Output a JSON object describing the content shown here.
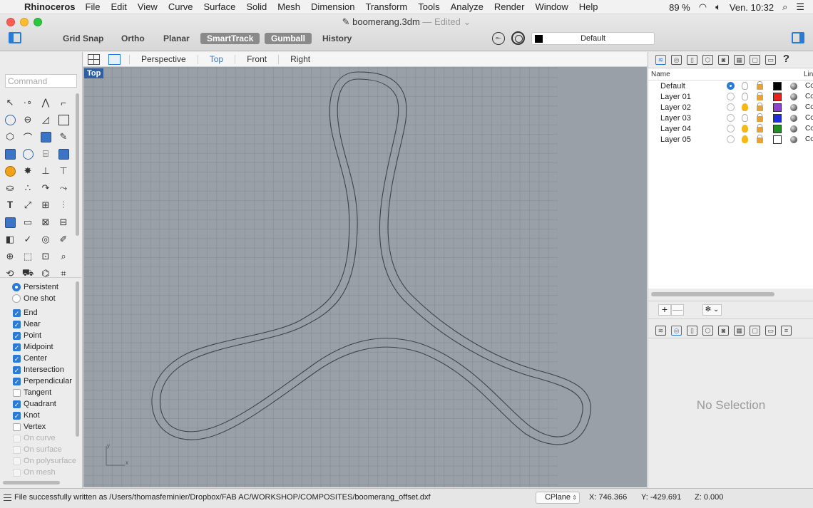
{
  "menubar": {
    "app_name": "Rhinoceros",
    "menus": [
      "File",
      "Edit",
      "View",
      "Curve",
      "Surface",
      "Solid",
      "Mesh",
      "Dimension",
      "Transform",
      "Tools",
      "Analyze",
      "Render",
      "Window",
      "Help"
    ],
    "battery": "89 %",
    "clock": "Ven. 10:32"
  },
  "window": {
    "title": "boomerang.3dm",
    "status": "— Edited"
  },
  "toolbar": {
    "grid_snap": "Grid Snap",
    "ortho": "Ortho",
    "planar": "Planar",
    "smarttrack": "SmartTrack",
    "gumball": "Gumball",
    "history": "History",
    "current_layer": "Default"
  },
  "command": {
    "placeholder": "Command"
  },
  "snap_modes": [
    {
      "label": "Persistent",
      "selected": true
    },
    {
      "label": "One shot",
      "selected": false
    }
  ],
  "osnaps": [
    {
      "label": "End",
      "checked": true,
      "enabled": true
    },
    {
      "label": "Near",
      "checked": true,
      "enabled": true
    },
    {
      "label": "Point",
      "checked": true,
      "enabled": true
    },
    {
      "label": "Midpoint",
      "checked": true,
      "enabled": true
    },
    {
      "label": "Center",
      "checked": true,
      "enabled": true
    },
    {
      "label": "Intersection",
      "checked": true,
      "enabled": true
    },
    {
      "label": "Perpendicular",
      "checked": true,
      "enabled": true
    },
    {
      "label": "Tangent",
      "checked": false,
      "enabled": true
    },
    {
      "label": "Quadrant",
      "checked": true,
      "enabled": true
    },
    {
      "label": "Knot",
      "checked": true,
      "enabled": true
    },
    {
      "label": "Vertex",
      "checked": false,
      "enabled": true
    },
    {
      "label": "On curve",
      "checked": false,
      "enabled": false
    },
    {
      "label": "On surface",
      "checked": false,
      "enabled": false
    },
    {
      "label": "On polysurface",
      "checked": false,
      "enabled": false
    },
    {
      "label": "On mesh",
      "checked": false,
      "enabled": false
    }
  ],
  "viewport_tabs": [
    {
      "label": "Perspective",
      "active": false
    },
    {
      "label": "Top",
      "active": true
    },
    {
      "label": "Front",
      "active": false
    },
    {
      "label": "Right",
      "active": false
    }
  ],
  "viewport": {
    "label": "Top",
    "axis_y": "y",
    "axis_x": "x"
  },
  "layers_panel": {
    "columns": {
      "name": "Name",
      "linetype": "Lin"
    },
    "layers": [
      {
        "name": "Default",
        "current": true,
        "visible": false,
        "color": "#000000",
        "linetype": "Co"
      },
      {
        "name": "Layer 01",
        "current": false,
        "visible": false,
        "color": "#e8211b",
        "linetype": "Co"
      },
      {
        "name": "Layer 02",
        "current": false,
        "visible": true,
        "color": "#8e3fd0",
        "linetype": "Co"
      },
      {
        "name": "Layer 03",
        "current": false,
        "visible": false,
        "color": "#1a2fe0",
        "linetype": "Co"
      },
      {
        "name": "Layer 04",
        "current": false,
        "visible": true,
        "color": "#1f8f1f",
        "linetype": "Co"
      },
      {
        "name": "Layer 05",
        "current": false,
        "visible": true,
        "color": "#ffffff",
        "linetype": "Co"
      }
    ],
    "add_label": "+",
    "remove_label": "—",
    "options_label": "✻ ⌄"
  },
  "properties_panel": {
    "empty_text": "No Selection"
  },
  "statusbar": {
    "message": "File successfully written as /Users/thomasfeminier/Dropbox/FAB AC/WORKSHOP/COMPOSITES/boomerang_offset.dxf",
    "cplane": "CPlane",
    "x": "X: 746.366",
    "y": "Y: -429.691",
    "z": "Z: 0.000"
  }
}
